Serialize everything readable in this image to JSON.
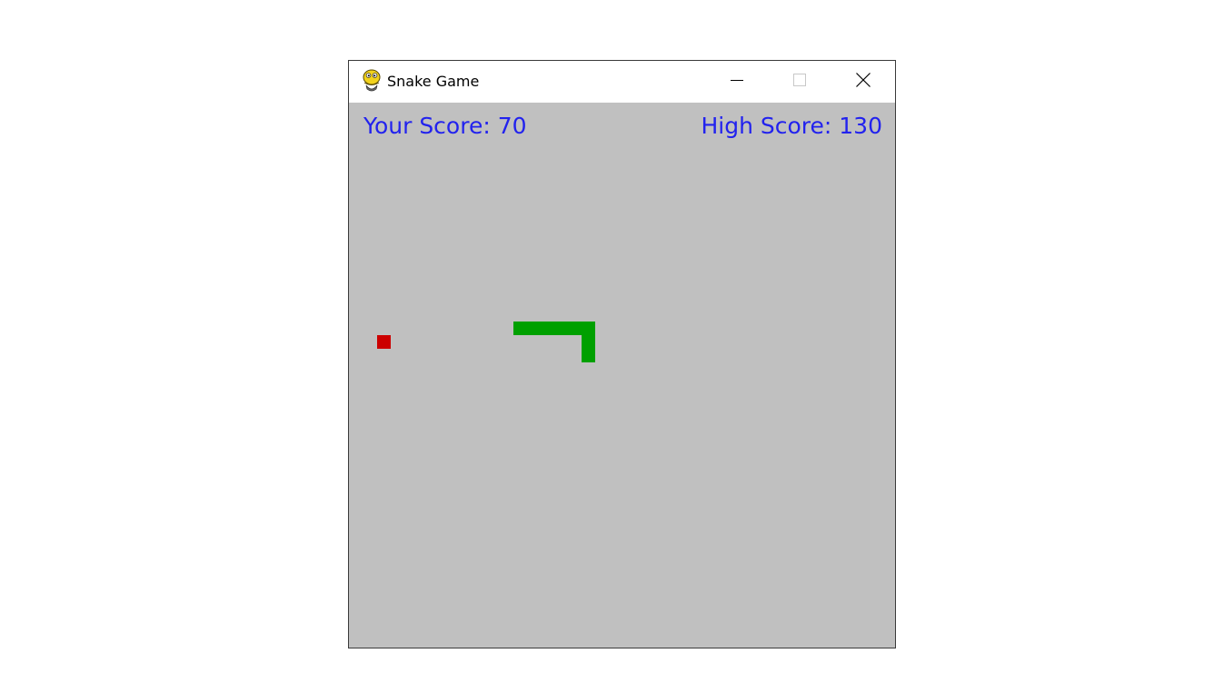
{
  "window": {
    "title": "Snake Game",
    "icon": "pygame-snake-icon"
  },
  "controls": {
    "minimize_icon": "minimize-icon",
    "maximize_icon": "maximize-icon",
    "close_icon": "close-icon"
  },
  "hud": {
    "your_score": "Your Score: 70",
    "high_score": "High Score: 130"
  },
  "colors": {
    "background": "#c0c0c0",
    "snake": "#00a000",
    "food": "#cc0000",
    "score_text": "#2222ee"
  }
}
